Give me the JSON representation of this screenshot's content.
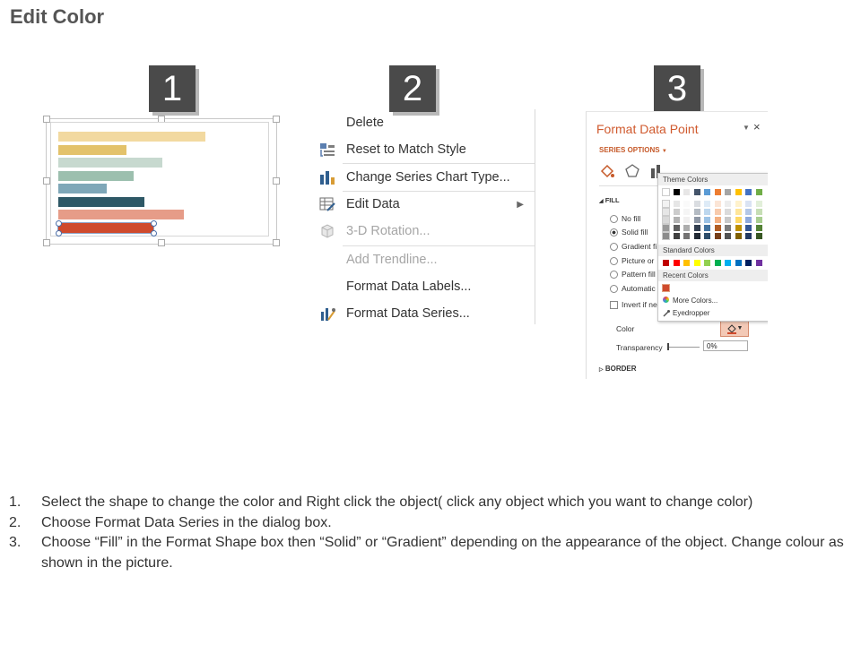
{
  "page": {
    "title": "Edit Color"
  },
  "steps_badges": [
    "1",
    "2",
    "3"
  ],
  "chart_panel": {
    "bars": [
      {
        "color": "#f2d9a0",
        "value": 0.82
      },
      {
        "color": "#e3c26b",
        "value": 0.38
      },
      {
        "color": "#c7d9cf",
        "value": 0.58
      },
      {
        "color": "#9cbfae",
        "value": 0.42
      },
      {
        "color": "#7fa7b8",
        "value": 0.27
      },
      {
        "color": "#2e5866",
        "value": 0.48
      },
      {
        "color": "#e69c88",
        "value": 0.7
      },
      {
        "color": "#cf4a2c",
        "value": 0.53
      }
    ],
    "selected_index": 7
  },
  "context_menu": {
    "items": [
      {
        "label": "Delete",
        "icon": "none",
        "disabled": false
      },
      {
        "label": "Reset to Match Style",
        "icon": "reset-style-icon",
        "disabled": false
      },
      {
        "label": "Change Series Chart Type...",
        "icon": "bar-chart-icon",
        "disabled": false
      },
      {
        "label": "Edit Data",
        "icon": "edit-data-icon",
        "disabled": false,
        "submenu": true
      },
      {
        "label": "3-D Rotation...",
        "icon": "cube-icon",
        "disabled": true
      },
      {
        "label": "Add Trendline...",
        "icon": "none",
        "disabled": true
      },
      {
        "label": "Format Data Labels...",
        "icon": "none",
        "disabled": false
      },
      {
        "label": "Format Data Series...",
        "icon": "format-series-icon",
        "disabled": false
      }
    ]
  },
  "format_panel": {
    "title": "Format Data Point",
    "series_options": "SERIES OPTIONS",
    "fill_header": "FILL",
    "fill_options": [
      "No fill",
      "Solid fill",
      "Gradient fi",
      "Picture or",
      "Pattern fill",
      "Automatic"
    ],
    "selected_fill": "Solid fill",
    "invert_label": "Invert if ne",
    "color_label": "Color",
    "transparency_label": "Transparency",
    "transparency_value": "0%",
    "border_header": "BORDER",
    "accent": "#d05a2e"
  },
  "color_picker": {
    "theme_header": "Theme Colors",
    "standard_header": "Standard Colors",
    "recent_header": "Recent Colors",
    "more_colors": "More Colors...",
    "eyedropper": "Eyedropper",
    "theme_top": [
      "#ffffff",
      "#000000",
      "#e7e6e6",
      "#44546a",
      "#5b9bd5",
      "#ed7d31",
      "#a5a5a5",
      "#ffc000",
      "#4472c4",
      "#70ad47"
    ],
    "standard": [
      "#c00000",
      "#ff0000",
      "#ffc000",
      "#ffff00",
      "#92d050",
      "#00b050",
      "#00b0f0",
      "#0070c0",
      "#002060",
      "#7030a0"
    ],
    "recent": [
      "#cf4a2c"
    ]
  },
  "instructions": [
    {
      "num": "1.",
      "text": "Select the shape to change the color and Right click the object( click any object which you want to change color)"
    },
    {
      "num": "2.",
      "text": "Choose Format Data Series in the dialog box."
    },
    {
      "num": "3.",
      "text": "Choose “Fill” in the Format Shape box then “Solid” or “Gradient” depending on the appearance of the object. Change colour as shown in the picture."
    }
  ]
}
